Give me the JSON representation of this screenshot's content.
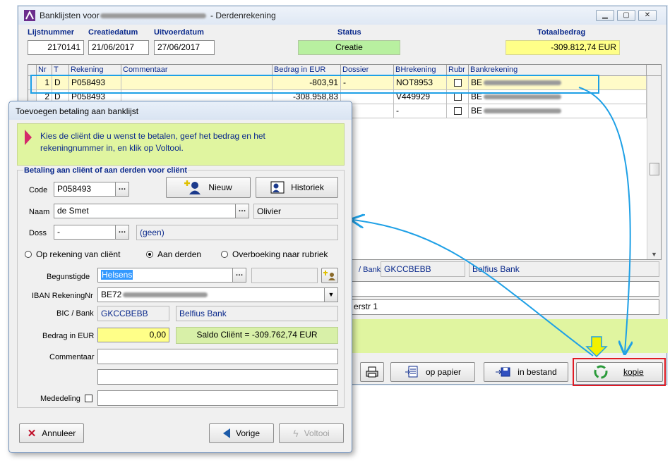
{
  "main": {
    "title_prefix": "Banklijsten voor",
    "title_suffix": "- Derdenrekening",
    "header_labels": {
      "lijstnummer": "Lijstnummer",
      "creatiedatum": "Creatiedatum",
      "uitvoerdatum": "Uitvoerdatum",
      "status": "Status",
      "totaalbedrag": "Totaalbedrag"
    },
    "lijstnummer": "2170141",
    "creatiedatum": "21/06/2017",
    "uitvoerdatum": "27/06/2017",
    "status": "Creatie",
    "totaalbedrag": "-309.812,74  EUR",
    "columns": [
      "Nr",
      "T",
      "Rekening",
      "Commentaar",
      "Bedrag in EUR",
      "Dossier",
      "BHrekening",
      "Rubr",
      "Bankrekening"
    ],
    "rows": [
      {
        "nr": "1",
        "t": "D",
        "rekening": "P058493",
        "commentaar": "",
        "bedrag": "-803,91",
        "dossier": "-",
        "bhrekening": "NOT8953"
      },
      {
        "nr": "2",
        "t": "D",
        "rekening": "P058493",
        "commentaar": "",
        "bedrag": "-308.958,83",
        "dossier": "",
        "bhrekening": "V449929"
      },
      {
        "nr": "",
        "t": "",
        "rekening": "",
        "commentaar": "",
        "bedrag": "",
        "dossier": "",
        "bhrekening": "-"
      }
    ],
    "bank_prefix": "BE",
    "detail": {
      "bank_label": "/ Bank",
      "bic": "GKCCBEBB",
      "bank": "Belfius Bank",
      "address_tail": "erstr 1"
    },
    "buttons": {
      "op_papier": "op papier",
      "in_bestand": "in bestand",
      "kopie": "kopie"
    }
  },
  "dialog": {
    "title": "Toevoegen betaling aan banklijst",
    "info": "Kies de cliënt die u wenst te betalen, geef het bedrag en het rekeningnummer in, en klik op Voltooi.",
    "section": "Betaling aan cliënt of aan derden voor cliënt",
    "labels": {
      "code": "Code",
      "naam": "Naam",
      "doss": "Doss",
      "begunstigde": "Begunstigde",
      "iban": "IBAN RekeningNr",
      "bic": "BIC / Bank",
      "bedrag": "Bedrag in EUR",
      "commentaar": "Commentaar",
      "mededeling": "Mededeling"
    },
    "code": "P058493",
    "naam": "de Smet",
    "voornaam": "Olivier",
    "doss": "-",
    "doss_text": "(geen)",
    "radios": [
      "Op rekening van cliënt",
      "Aan derden",
      "Overboeking naar rubriek"
    ],
    "begunstigde": "Helsens",
    "iban_prefix": "BE72",
    "bic": "GKCCBEBB",
    "bank": "Belfius Bank",
    "bedrag": "0,00",
    "saldo": "Saldo Cliënt = -309.762,74 EUR",
    "buttons": {
      "nieuw": "Nieuw",
      "historiek": "Historiek",
      "annuleer": "Annuleer",
      "vorige": "Vorige",
      "voltooi": "Voltooi"
    }
  },
  "colors": {
    "status_green": "#b8f0a0",
    "total_yellow": "#ffff88",
    "highlight_blue": "#1ea0e6",
    "kopie_red": "#e01b24",
    "info_green": "#e0f5a0"
  }
}
